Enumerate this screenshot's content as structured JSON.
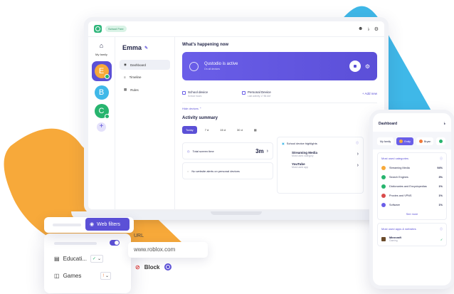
{
  "colors": {
    "accent": "#5b50d6",
    "teal": "#3fb8e8",
    "orange": "#f7a93a",
    "green": "#27b46e"
  },
  "laptop": {
    "topbar": {
      "school_pill": "School Free"
    },
    "family": {
      "home_label": "My family",
      "kids": [
        {
          "initial": "E"
        },
        {
          "initial": "B"
        },
        {
          "initial": "C"
        }
      ]
    },
    "nav": {
      "child_name": "Emma",
      "items": [
        {
          "label": "Dashboard",
          "icon": "dashboard-icon"
        },
        {
          "label": "Timeline",
          "icon": "timeline-icon"
        },
        {
          "label": "Rules",
          "icon": "rules-icon"
        }
      ]
    },
    "main": {
      "happening_title": "What's happening now",
      "banner": {
        "title": "Qustodio is active",
        "subtitle": "On all devices"
      },
      "devices": [
        {
          "name": "School device",
          "sub": "School hours"
        },
        {
          "name": "Personal Device",
          "sub": "Last activity 17:56 AM"
        }
      ],
      "add_new": "Add new",
      "hide_devices": "Hide devices",
      "activity_title": "Activity summary",
      "tabs": [
        "Today",
        "7 d",
        "15 d",
        "30 d"
      ],
      "screen_time": {
        "label": "Total screen time",
        "value": "3m"
      },
      "alert_text": "No website alerts on personal devices",
      "highlights": {
        "title": "School device highlights",
        "items": [
          {
            "name": "Streaming Media",
            "sub": "Most used category"
          },
          {
            "name": "YouTube",
            "sub": "Most used app"
          }
        ]
      }
    }
  },
  "phone": {
    "title": "Dashboard",
    "tabs": [
      "My family",
      "Emily",
      "Bryan"
    ],
    "categories_title": "Most used categories",
    "categories": [
      {
        "name": "Streaming Media",
        "pct": "94%",
        "color": "#f7a93a"
      },
      {
        "name": "Search Engines",
        "pct": "3%",
        "color": "#27b46e"
      },
      {
        "name": "Dictionaries and Encyclopedias",
        "pct": "1%",
        "color": "#27b46e"
      },
      {
        "name": "Proxies and VPNS",
        "pct": "1%",
        "color": "#d94b4b"
      },
      {
        "name": "Software",
        "pct": "1%",
        "color": "#6a5ee8"
      }
    ],
    "see_more": "See more",
    "apps_title": "Most used apps & websites",
    "app": {
      "name": "Minecraft",
      "sub": "Gaming"
    }
  },
  "web_filters": {
    "button": "Web filters",
    "rows": [
      {
        "label": "Educati..."
      },
      {
        "label": "Games"
      }
    ],
    "url_label": "URL",
    "url_value": "www.roblox.com",
    "block_label": "Block"
  }
}
